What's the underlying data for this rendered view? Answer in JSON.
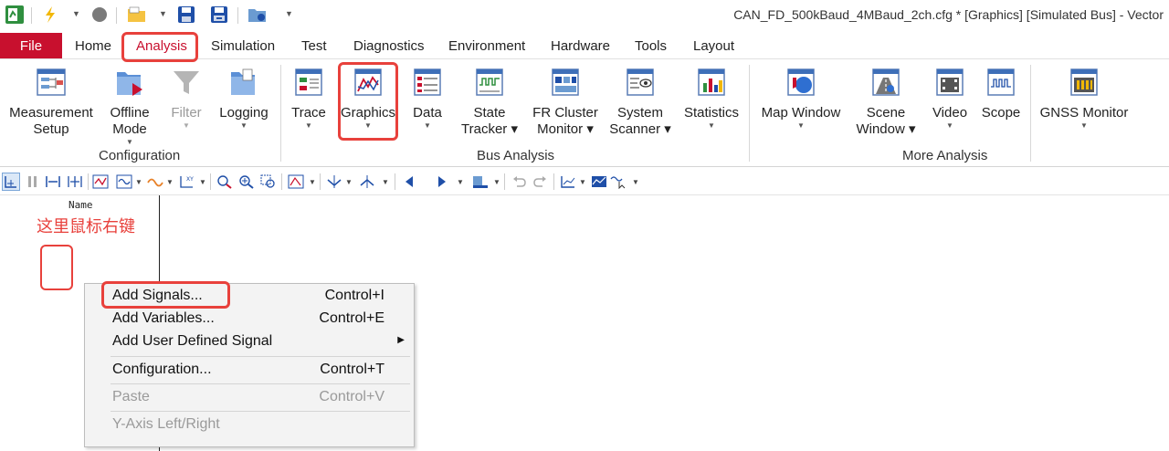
{
  "window": {
    "title": "CAN_FD_500kBaud_4MBaud_2ch.cfg * [Graphics] [Simulated Bus] - Vector"
  },
  "ribbon_tabs": [
    "File",
    "Home",
    "Analysis",
    "Simulation",
    "Test",
    "Diagnostics",
    "Environment",
    "Hardware",
    "Tools",
    "Layout"
  ],
  "selected_tab": "Analysis",
  "groups": {
    "configuration": {
      "label": "Configuration",
      "measurement_setup": [
        "Measurement",
        "Setup"
      ],
      "offline_mode": [
        "Offline",
        "Mode"
      ],
      "filter": "Filter",
      "logging": "Logging"
    },
    "bus_analysis": {
      "label": "Bus Analysis",
      "trace": "Trace",
      "graphics": "Graphics",
      "data": "Data",
      "state_tracker": [
        "State",
        "Tracker"
      ],
      "fr_cluster_monitor": [
        "FR Cluster",
        "Monitor"
      ],
      "system_scanner": [
        "System",
        "Scanner"
      ],
      "statistics": "Statistics"
    },
    "more_analysis": {
      "label": "More Analysis",
      "map_window": "Map Window",
      "scene_window": [
        "Scene",
        "Window"
      ],
      "video": "Video",
      "scope": "Scope",
      "gnss_monitor": "GNSS Monitor"
    }
  },
  "graphics_window": {
    "column_header": "Name",
    "annotation": "这里鼠标右键"
  },
  "context_menu": {
    "items": [
      {
        "label": "Add Signals...",
        "shortcut": "Control+I",
        "enabled": true
      },
      {
        "label": "Add Variables...",
        "shortcut": "Control+E",
        "enabled": true
      },
      {
        "label": "Add User Defined Signal",
        "shortcut": "",
        "enabled": true,
        "submenu": true
      },
      {
        "label": "Configuration...",
        "shortcut": "Control+T",
        "enabled": true
      },
      {
        "label": "Paste",
        "shortcut": "Control+V",
        "enabled": false
      },
      {
        "label": "Y-Axis Left/Right",
        "shortcut": "",
        "enabled": false
      }
    ]
  },
  "colors": {
    "file_tab": "#c8102e",
    "selected_tab_text": "#c8102e",
    "highlight": "#e8413c",
    "disabled_text": "#9a9a9a"
  },
  "icons": [
    "app-icon",
    "lightning-icon",
    "stop-icon",
    "open-folder-icon",
    "save-icon",
    "save-all-icon",
    "package-icon",
    "measurement-setup-icon",
    "offline-mode-icon",
    "filter-icon",
    "logging-icon",
    "trace-icon",
    "graphics-icon",
    "data-icon",
    "state-tracker-icon",
    "fr-cluster-monitor-icon",
    "system-scanner-icon",
    "statistics-icon",
    "map-window-icon",
    "scene-window-icon",
    "video-icon",
    "scope-icon",
    "gnss-monitor-icon"
  ]
}
